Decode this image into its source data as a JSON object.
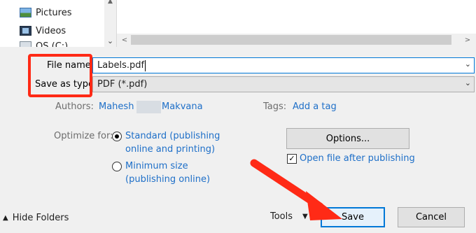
{
  "nav": {
    "items": [
      {
        "label": "Pictures",
        "icon": "pictures-icon"
      },
      {
        "label": "Videos",
        "icon": "videos-icon"
      },
      {
        "label": "OS (C:)",
        "icon": "drive-icon"
      }
    ]
  },
  "form": {
    "filename_label": "File name:",
    "filename_value": "Labels.pdf",
    "savetype_label": "Save as type:",
    "savetype_value": "PDF (*.pdf)"
  },
  "meta": {
    "authors_label": "Authors:",
    "author_first": "Mahesh",
    "author_last": "Makvana",
    "tags_label": "Tags:",
    "tags_link": "Add a tag"
  },
  "optimize": {
    "label": "Optimize for:",
    "standard_line1": "Standard (publishing",
    "standard_line2": "online and printing)",
    "minimum_line1": "Minimum size",
    "minimum_line2": "(publishing online)",
    "selected": "standard"
  },
  "actions": {
    "options_label": "Options...",
    "open_after_label": "Open file after publishing",
    "open_after_checked": true,
    "hide_folders_label": "Hide Folders",
    "tools_label": "Tools",
    "save_label": "Save",
    "cancel_label": "Cancel"
  },
  "colors": {
    "accent": "#0078d7",
    "link": "#1e6fc8",
    "annotation_red": "#ff2a16"
  }
}
